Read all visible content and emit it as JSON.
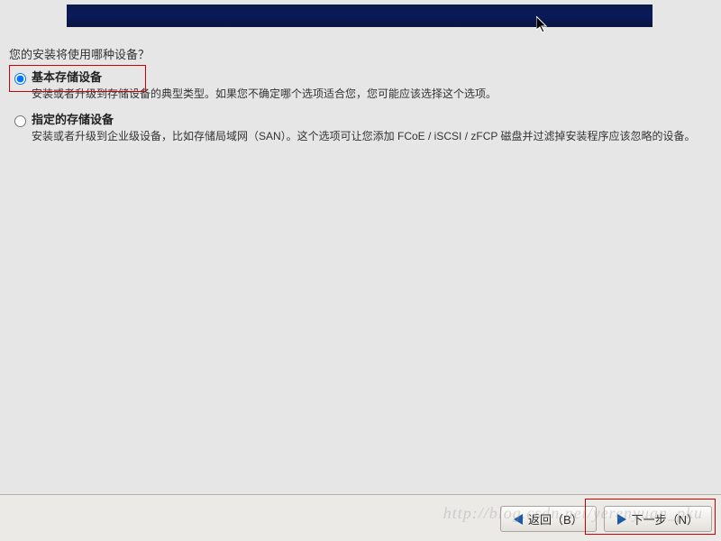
{
  "prompt": "您的安装将使用哪种设备？",
  "options": {
    "basic": {
      "title": "基本存储设备",
      "desc": "安装或者升级到存储设备的典型类型。如果您不确定哪个选项适合您，您可能应该选择这个选项。"
    },
    "specified": {
      "title": "指定的存储设备",
      "desc": "安装或者升级到企业级设备，比如存储局域网（SAN）。这个选项可让您添加 FCoE / iSCSI / zFCP 磁盘并过滤掉安装程序应该忽略的设备。"
    }
  },
  "buttons": {
    "back": "返回（B）",
    "next": "下一步（N）"
  },
  "watermark": "http://blog.csdn.net/yerenyuan_pku"
}
